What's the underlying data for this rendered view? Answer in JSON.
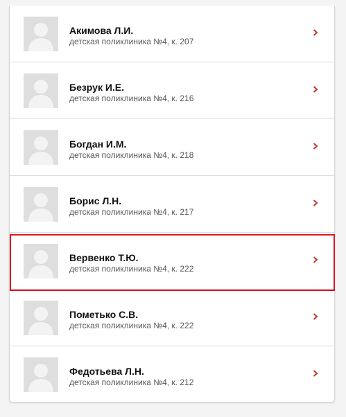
{
  "doctors": [
    {
      "name": "Акимова Л.И.",
      "details": "детская поликлиника №4, к. 207"
    },
    {
      "name": "Безрук И.Е.",
      "details": "детская поликлиника №4, к. 216"
    },
    {
      "name": "Богдан И.М.",
      "details": "детская поликлиника №4, к. 218"
    },
    {
      "name": "Борис Л.Н.",
      "details": "детская поликлиника №4, к. 217"
    },
    {
      "name": "Вервенко Т.Ю.",
      "details": "детская поликлиника №4, к. 222"
    },
    {
      "name": "Пометько С.В.",
      "details": "детская поликлиника №4, к. 222"
    },
    {
      "name": "Федотьева Л.Н.",
      "details": "детская поликлиника №4, к. 212"
    }
  ],
  "colors": {
    "chevron": "#c0392b",
    "highlight": "#e0141e",
    "avatar_bg": "#dedede",
    "avatar_figure": "#f3f3f3"
  },
  "icons": {
    "avatar": "user-placeholder-icon",
    "row_action": "chevron-right-icon"
  },
  "highlighted_index": 4
}
